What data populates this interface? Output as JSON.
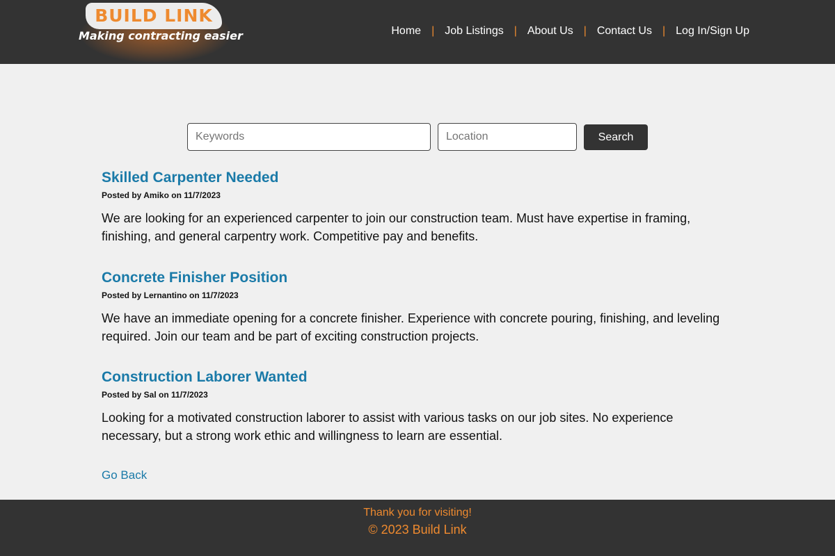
{
  "brand": {
    "name": "BUILD LINK",
    "tagline": "Making contracting easier",
    "accent_color": "#ee8a2f",
    "link_color": "#1a7aa8"
  },
  "nav": {
    "items": [
      "Home",
      "Job Listings",
      "About Us",
      "Contact Us",
      "Log In/Sign Up"
    ],
    "separator": "|"
  },
  "search": {
    "keywords_placeholder": "Keywords",
    "keywords_value": "",
    "location_placeholder": "Location",
    "location_value": "",
    "button_label": "Search"
  },
  "listings": [
    {
      "title": "Skilled Carpenter Needed",
      "meta": "Posted by Amiko on 11/7/2023",
      "description": "We are looking for an experienced carpenter to join our construction team. Must have expertise in framing, finishing, and general carpentry work. Competitive pay and benefits."
    },
    {
      "title": "Concrete Finisher Position",
      "meta": "Posted by Lernantino on 11/7/2023",
      "description": "We have an immediate opening for a concrete finisher. Experience with concrete pouring, finishing, and leveling required. Join our team and be part of exciting construction projects."
    },
    {
      "title": "Construction Laborer Wanted",
      "meta": "Posted by Sal on 11/7/2023",
      "description": "Looking for a motivated construction laborer to assist with various tasks on our job sites. No experience necessary, but a strong work ethic and willingness to learn are essential."
    }
  ],
  "go_back_label": "Go Back",
  "footer": {
    "thanks": "Thank you for visiting!",
    "copyright": "© 2023 Build Link"
  }
}
